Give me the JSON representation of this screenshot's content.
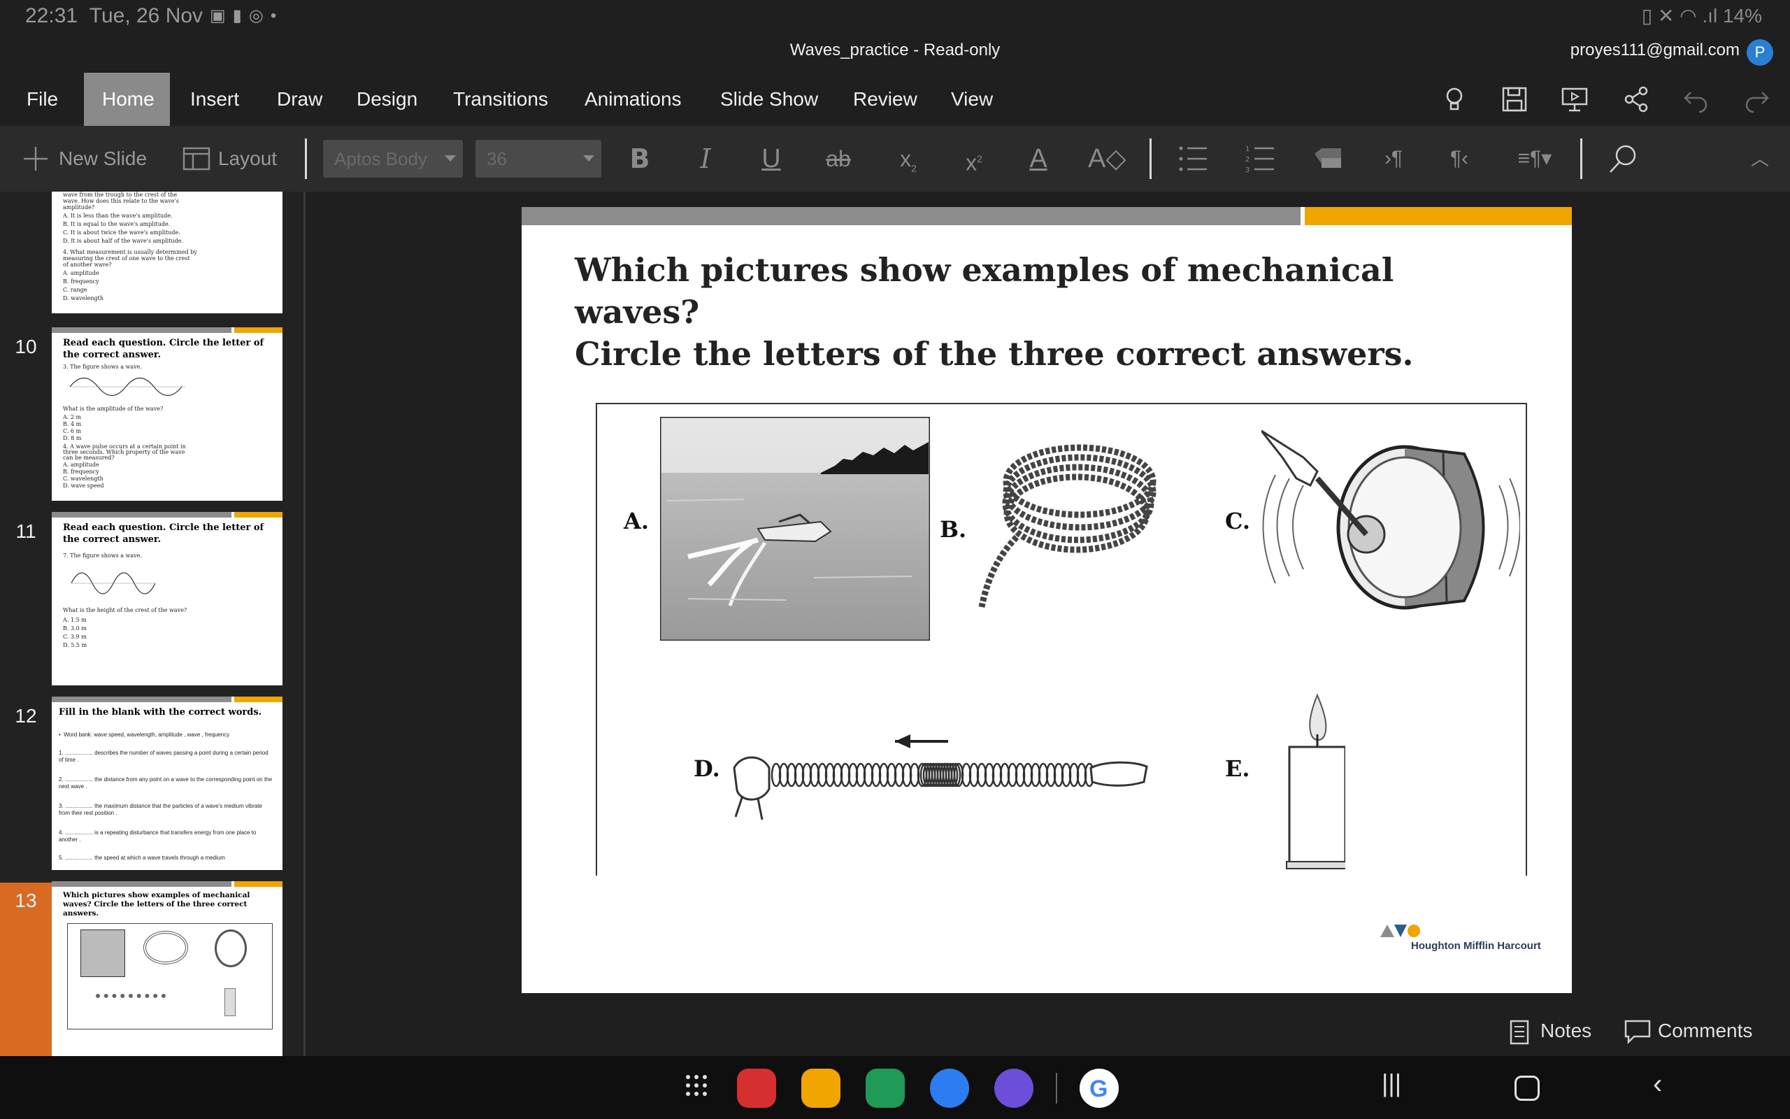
{
  "status_bar": {
    "time": "22:31",
    "date": "Tue, 26 Nov",
    "battery": "14%"
  },
  "title_bar": {
    "document": "Waves_practice - Read-only",
    "account": "proyes111@gmail.com",
    "avatar_letter": "P"
  },
  "menu": [
    "File",
    "Home",
    "Insert",
    "Draw",
    "Design",
    "Transitions",
    "Animations",
    "Slide Show",
    "Review",
    "View"
  ],
  "toolbar": {
    "new_slide": "New Slide",
    "layout": "Layout",
    "font_name": "Aptos Body",
    "font_size": "36"
  },
  "thumbnails": [
    {
      "num": "10",
      "title": "Read each question. Circle the letter of the correct answer."
    },
    {
      "num": "11",
      "title": "Read each question. Circle the letter of the correct answer."
    },
    {
      "num": "12",
      "title": "Fill in the blank with the correct words."
    },
    {
      "num": "13",
      "title": "Which pictures show examples of mechanical waves? Circle the letters of the three correct answers."
    }
  ],
  "slide": {
    "title_line1": "Which pictures show examples of mechanical waves?",
    "title_line2": "Circle the letters of the three correct answers.",
    "labels": {
      "a": "A.",
      "b": "B.",
      "c": "C.",
      "d": "D.",
      "e": "E."
    },
    "publisher": "Houghton Mifflin Harcourt"
  },
  "bottom": {
    "notes": "Notes",
    "comments": "Comments"
  },
  "colors": {
    "accent_orange": "#f0a500",
    "selected_slide": "#d86a22",
    "avatar": "#2a7fd4"
  }
}
